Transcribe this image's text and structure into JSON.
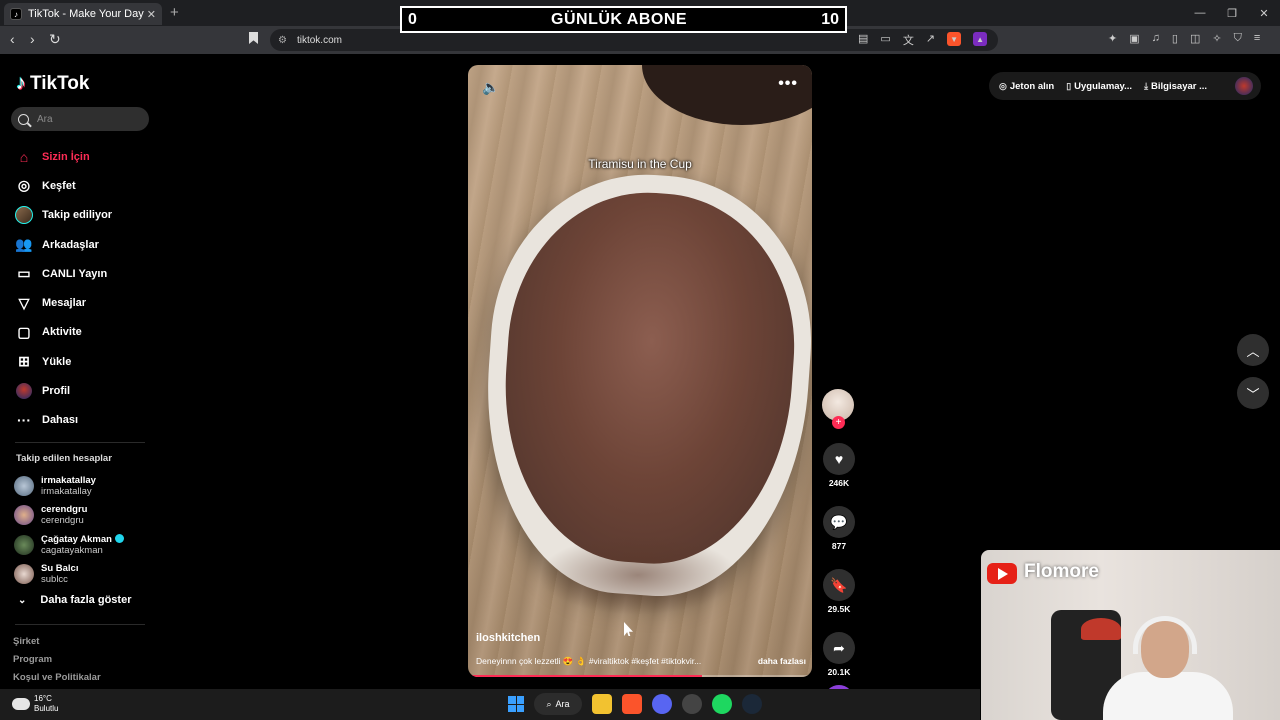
{
  "browser": {
    "tab_title": "TikTok - Make Your Day",
    "tab_favicon": "tiktok-icon",
    "url": "tiktok.com",
    "new_tab": "+",
    "close_tab": "✕"
  },
  "overlay": {
    "left_count": "0",
    "title": "GÜNLÜK ABONE",
    "right_count": "10"
  },
  "tiktok": {
    "logo": "TikTok",
    "search_placeholder": "Ara",
    "nav": [
      {
        "label": "Sizin İçin",
        "icon": "home-icon",
        "active": true
      },
      {
        "label": "Keşfet",
        "icon": "compass-icon"
      },
      {
        "label": "Takip ediliyor",
        "icon": "following-avatar"
      },
      {
        "label": "Arkadaşlar",
        "icon": "friends-icon"
      },
      {
        "label": "CANLI Yayın",
        "icon": "live-icon"
      },
      {
        "label": "Mesajlar",
        "icon": "send-icon"
      },
      {
        "label": "Aktivite",
        "icon": "inbox-icon"
      },
      {
        "label": "Yükle",
        "icon": "upload-icon"
      },
      {
        "label": "Profil",
        "icon": "profile-avatar"
      },
      {
        "label": "Dahası",
        "icon": "more-icon"
      }
    ],
    "following_title": "Takip edilen hesaplar",
    "following": [
      {
        "name": "irmakatallay",
        "handle": "irmakatallay",
        "verified": false
      },
      {
        "name": "cerendgru",
        "handle": "cerendgru",
        "verified": false
      },
      {
        "name": "Çağatay Akman",
        "handle": "cagatayakman",
        "verified": true
      },
      {
        "name": "Su Balcı",
        "handle": "sublcc",
        "verified": false
      }
    ],
    "show_more": "Daha fazla göster",
    "footer": [
      "Şirket",
      "Program",
      "Koşul ve Politikalar"
    ]
  },
  "video": {
    "overlay_title": "Tiramisu in the Cup",
    "username": "iloshkitchen",
    "caption": "Deneyinnn çok lezzetli 😍 👌 #viraltiktok #keşfet #tiktokvir...",
    "caption_more": "daha fazlası",
    "progress": 0.68,
    "menu": "•••"
  },
  "actions": {
    "likes": "246K",
    "comments": "877",
    "saves": "29.5K",
    "shares": "20.1K"
  },
  "header_right": {
    "coins": "Jeton alın",
    "app": "Uygulamay...",
    "desktop": "Bilgisayar ..."
  },
  "webcam": {
    "channel": "Flomore"
  },
  "taskbar": {
    "temp": "16°C",
    "weather": "Bulutlu",
    "search": "Ara"
  }
}
